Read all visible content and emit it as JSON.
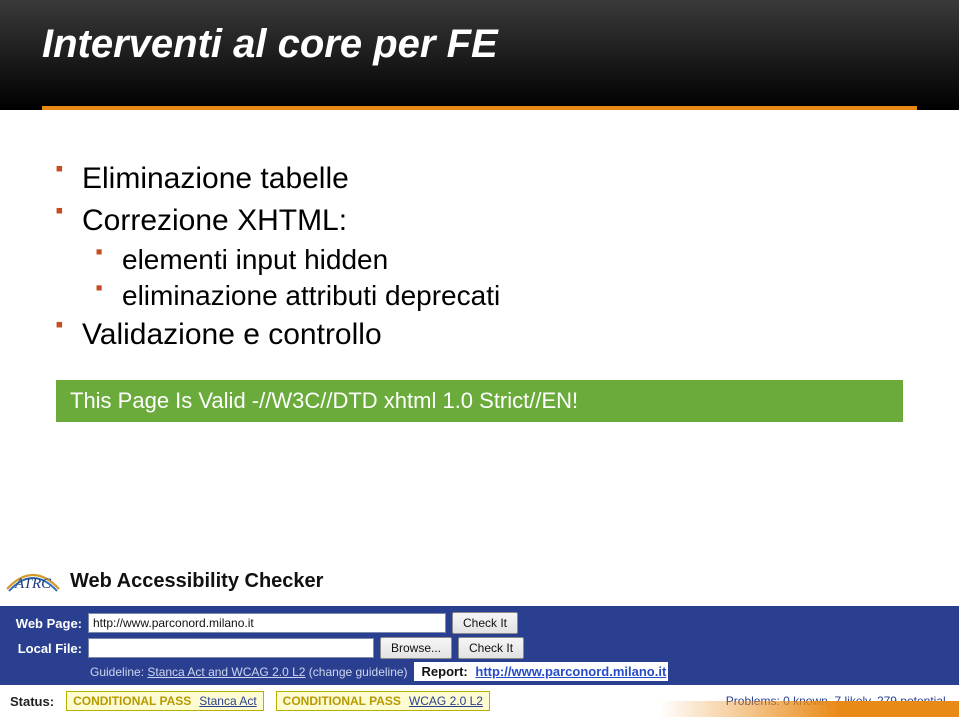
{
  "slide": {
    "title": "Interventi al core per FE"
  },
  "bullets": {
    "b1": "Eliminazione tabelle",
    "b2": "Correzione XHTML:",
    "b2a": "elementi input hidden",
    "b2b": "eliminazione attributi deprecati",
    "b3": "Validazione e controllo"
  },
  "valid_banner": "This Page Is Valid -//W3C//DTD xhtml 1.0 Strict//EN!",
  "checker": {
    "logo_text": "ATRC",
    "title": "Web Accessibility Checker",
    "labels": {
      "web_page": "Web Page:",
      "local_file": "Local File:",
      "guideline_prefix": "Guideline: ",
      "guideline_text": "Stanca Act and WCAG 2.0 L2",
      "change_guideline": " (change guideline)",
      "report": "Report: ",
      "status": "Status:"
    },
    "inputs": {
      "web_page_value": "http://www.parconord.milano.it",
      "local_file_value": ""
    },
    "buttons": {
      "check_it_1": "Check It",
      "browse": "Browse...",
      "check_it_2": "Check It"
    },
    "report_url": "http://www.parconord.milano.it",
    "pass1": {
      "text": "CONDITIONAL PASS",
      "sub": "Stanca Act"
    },
    "pass2": {
      "text": "CONDITIONAL PASS",
      "sub": "WCAG 2.0 L2"
    },
    "problems": "Problems: 0 known, 7 likely, 279 potential."
  }
}
